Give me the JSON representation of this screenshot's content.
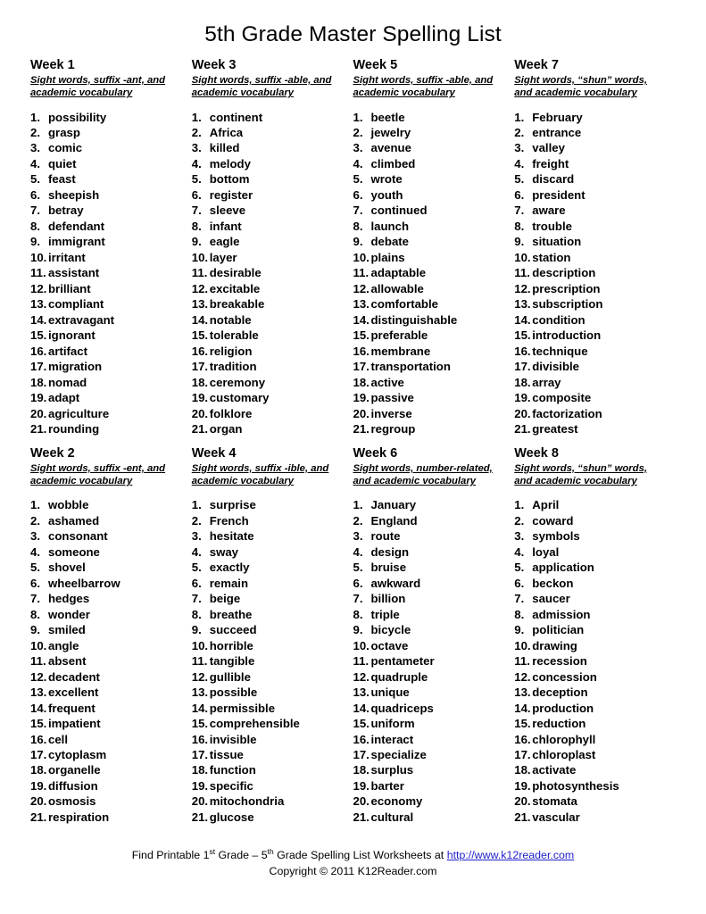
{
  "document": {
    "title": "5th Grade Master Spelling List"
  },
  "columns": [
    {
      "top": {
        "title": "Week 1",
        "subtitle": "Sight words, suffix -ant, and academic vocabulary",
        "words": [
          "possibility",
          "grasp",
          "comic",
          "quiet",
          "feast",
          "sheepish",
          "betray",
          "defendant",
          "immigrant",
          "irritant",
          "assistant",
          "brilliant",
          "compliant",
          "extravagant",
          "ignorant",
          "artifact",
          "migration",
          "nomad",
          "adapt",
          "agriculture",
          "rounding"
        ]
      },
      "bottom": {
        "title": "Week 2",
        "subtitle": "Sight words, suffix -ent, and academic vocabulary",
        "words": [
          "wobble",
          "ashamed",
          "consonant",
          "someone",
          "shovel",
          "wheelbarrow",
          "hedges",
          "wonder",
          "smiled",
          "angle",
          "absent",
          "decadent",
          "excellent",
          "frequent",
          "impatient",
          "cell",
          "cytoplasm",
          "organelle",
          "diffusion",
          "osmosis",
          "respiration"
        ]
      }
    },
    {
      "top": {
        "title": "Week 3",
        "subtitle": "Sight words, suffix -able, and academic vocabulary",
        "words": [
          "continent",
          "Africa",
          "killed",
          "melody",
          "bottom",
          "register",
          "sleeve",
          "infant",
          "eagle",
          "layer",
          "desirable",
          "excitable",
          "breakable",
          "notable",
          "tolerable",
          "religion",
          "tradition",
          "ceremony",
          "customary",
          "folklore",
          "organ"
        ]
      },
      "bottom": {
        "title": "Week 4",
        "subtitle": "Sight words, suffix -ible, and academic vocabulary",
        "words": [
          "surprise",
          "French",
          "hesitate",
          "sway",
          "exactly",
          "remain",
          "beige",
          "breathe",
          "succeed",
          "horrible",
          "tangible",
          "gullible",
          "possible",
          "permissible",
          "comprehensible",
          "invisible",
          "tissue",
          "function",
          "specific",
          "mitochondria",
          "glucose"
        ]
      }
    },
    {
      "top": {
        "title": "Week 5",
        "subtitle": "Sight words, suffix -able, and academic vocabulary",
        "words": [
          "beetle",
          "jewelry",
          "avenue",
          "climbed",
          "wrote",
          "youth",
          "continued",
          "launch",
          "debate",
          "plains",
          "adaptable",
          "allowable",
          "comfortable",
          "distinguishable",
          "preferable",
          "membrane",
          "transportation",
          "active",
          "passive",
          "inverse",
          "regroup"
        ]
      },
      "bottom": {
        "title": "Week 6",
        "subtitle": "Sight words, number-related, and academic vocabulary",
        "words": [
          "January",
          "England",
          "route",
          "design",
          "bruise",
          "awkward",
          "billion",
          "triple",
          "bicycle",
          "octave",
          "pentameter",
          "quadruple",
          "unique",
          "quadriceps",
          "uniform",
          "interact",
          "specialize",
          "surplus",
          "barter",
          "economy",
          "cultural"
        ]
      }
    },
    {
      "top": {
        "title": "Week 7",
        "subtitle": "Sight words, “shun” words, and academic vocabulary",
        "words": [
          "February",
          "entrance",
          "valley",
          "freight",
          "discard",
          "president",
          "aware",
          "trouble",
          "situation",
          "station",
          "description",
          "prescription",
          "subscription",
          "condition",
          "introduction",
          "technique",
          "divisible",
          "array",
          "composite",
          "factorization",
          "greatest"
        ]
      },
      "bottom": {
        "title": "Week 8",
        "subtitle": "Sight words, “shun” words, and academic vocabulary",
        "words": [
          "April",
          "coward",
          "symbols",
          "loyal",
          "application",
          "beckon",
          "saucer",
          "admission",
          "politician",
          "drawing",
          "recession",
          "concession",
          "deception",
          "production",
          "reduction",
          "chlorophyll",
          "chloroplast",
          "activate",
          "photosynthesis",
          "stomata",
          "vascular"
        ]
      }
    }
  ],
  "footer": {
    "line1_pre": "Find Printable 1",
    "line1_sup1": "st",
    "line1_mid": " Grade – 5",
    "line1_sup2": "th",
    "line1_post": " Grade Spelling List Worksheets at ",
    "link_text": "http://www.k12reader.com",
    "line2": "Copyright © 2011 K12Reader.com",
    "link_color": "#2222cc"
  }
}
